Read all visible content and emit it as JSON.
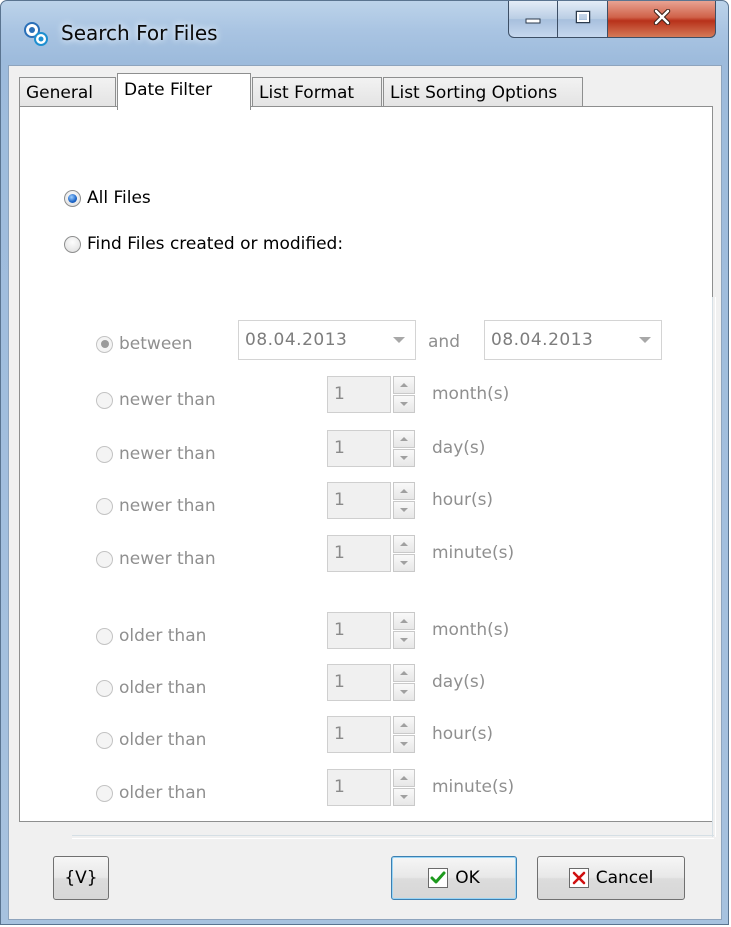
{
  "window": {
    "title": "Search For Files",
    "icon": "gears-icon"
  },
  "tabs": [
    {
      "label": "General",
      "active": false
    },
    {
      "label": "Date Filter",
      "active": true
    },
    {
      "label": "List Format",
      "active": false
    },
    {
      "label": "List Sorting Options",
      "active": false
    }
  ],
  "filter": {
    "all_files_label": "All Files",
    "all_files_selected": true,
    "find_label": "Find Files created or modified:",
    "find_selected": false
  },
  "between": {
    "label": "between",
    "from_date": "08.04.2013",
    "and_label": "and",
    "to_date": "08.04.2013"
  },
  "newer": [
    {
      "label": "newer than",
      "value": "1",
      "unit": "month(s)"
    },
    {
      "label": "newer than",
      "value": "1",
      "unit": "day(s)"
    },
    {
      "label": "newer than",
      "value": "1",
      "unit": "hour(s)"
    },
    {
      "label": "newer than",
      "value": "1",
      "unit": "minute(s)"
    }
  ],
  "older": [
    {
      "label": "older than",
      "value": "1",
      "unit": "month(s)"
    },
    {
      "label": "older than",
      "value": "1",
      "unit": "day(s)"
    },
    {
      "label": "older than",
      "value": "1",
      "unit": "hour(s)"
    },
    {
      "label": "older than",
      "value": "1",
      "unit": "minute(s)"
    }
  ],
  "buttons": {
    "variables": "{V}",
    "ok": "OK",
    "cancel": "Cancel"
  },
  "colors": {
    "ok_check": "#1e9a1e",
    "cancel_x": "#d01010",
    "radio_selected": "#1b64c8"
  }
}
